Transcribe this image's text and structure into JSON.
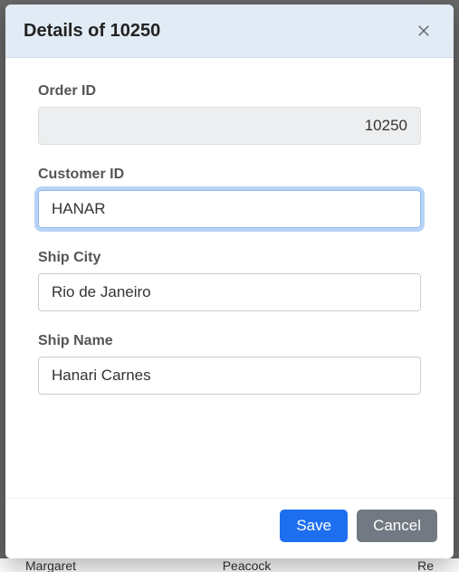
{
  "modal": {
    "title": "Details of 10250",
    "fields": {
      "orderId": {
        "label": "Order ID",
        "value": "10250"
      },
      "customerId": {
        "label": "Customer ID",
        "value": "HANAR"
      },
      "shipCity": {
        "label": "Ship City",
        "value": "Rio de Janeiro"
      },
      "shipName": {
        "label": "Ship Name",
        "value": "Hanari Carnes"
      }
    },
    "buttons": {
      "save": "Save",
      "cancel": "Cancel"
    }
  },
  "background": {
    "left": "Margaret",
    "mid": "Peacock",
    "right": "Re"
  }
}
